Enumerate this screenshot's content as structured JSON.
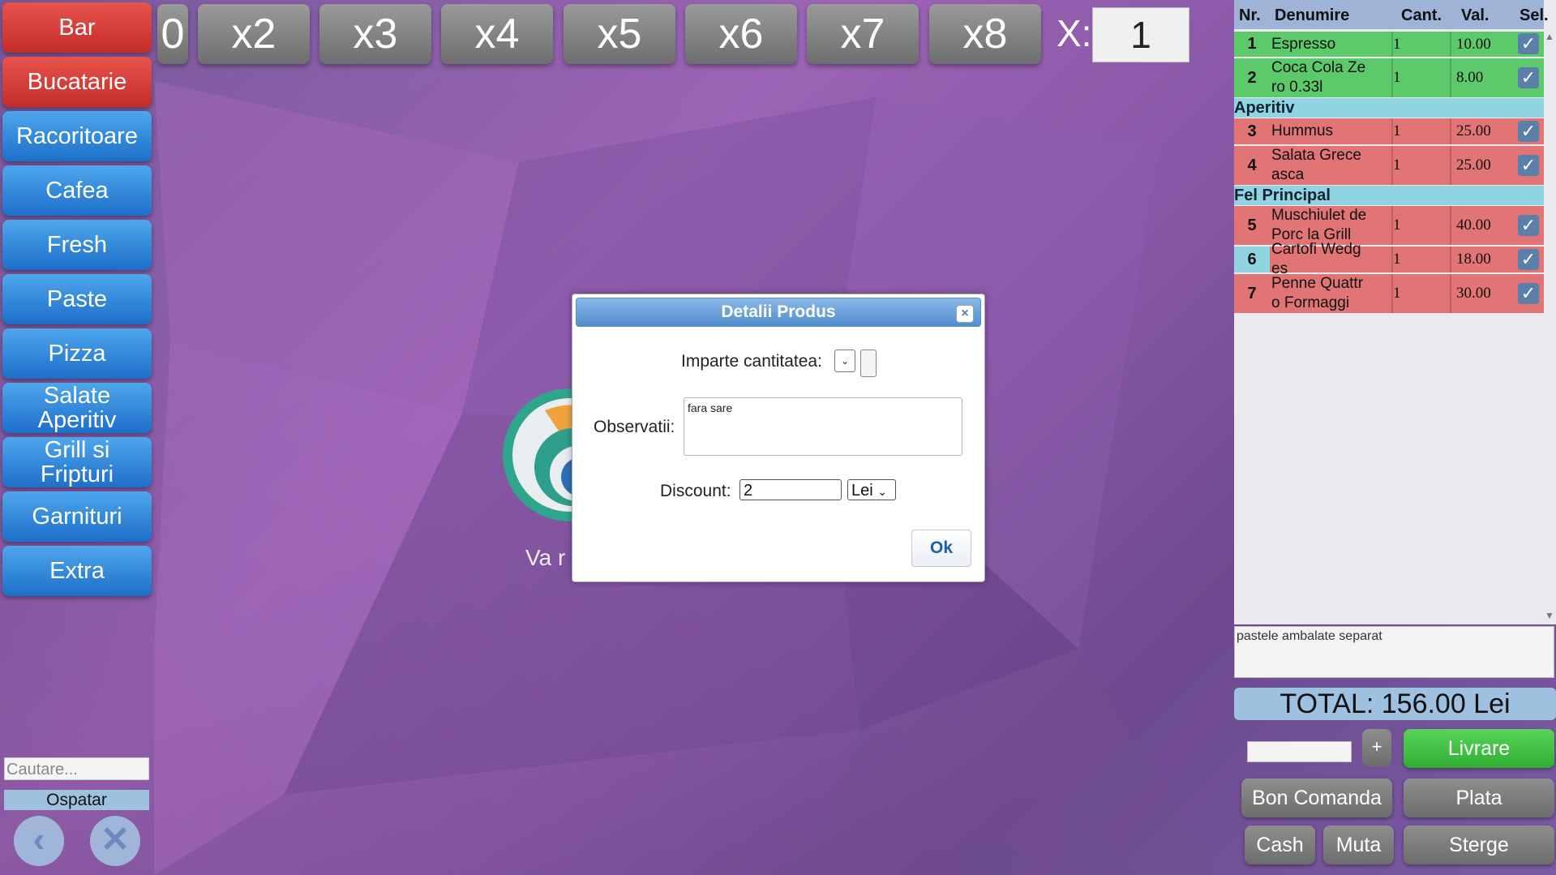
{
  "categories": [
    {
      "label": "Bar",
      "style": "red"
    },
    {
      "label": "Bucatarie",
      "style": "red"
    },
    {
      "label": "Racoritoare",
      "style": "blue"
    },
    {
      "label": "Cafea",
      "style": "blue"
    },
    {
      "label": "Fresh",
      "style": "blue"
    },
    {
      "label": "Paste",
      "style": "blue"
    },
    {
      "label": "Pizza",
      "style": "blue"
    },
    {
      "label": "Salate Aperitiv",
      "style": "blue"
    },
    {
      "label": "Grill si Fripturi",
      "style": "blue"
    },
    {
      "label": "Garnituri",
      "style": "blue"
    },
    {
      "label": "Extra",
      "style": "blue"
    }
  ],
  "multipliers": [
    "0",
    "x2",
    "x3",
    "x4",
    "x5",
    "x6",
    "x7",
    "x8"
  ],
  "multiplier_label": "X:",
  "multiplier_value": "1",
  "order": {
    "headers": {
      "nr": "Nr.",
      "name": "Denumire",
      "qty": "Cant.",
      "val": "Val.",
      "sel": "Sel."
    },
    "groups": [
      {
        "section": "",
        "rows": [
          {
            "nr": "1",
            "name": "Espresso",
            "qty": "1",
            "val": "10.00",
            "color": "green"
          },
          {
            "nr": "2",
            "name": "Coca Cola Zero 0.33l",
            "qty": "1",
            "val": "8.00",
            "color": "green"
          }
        ]
      },
      {
        "section": "Aperitiv",
        "rows": [
          {
            "nr": "3",
            "name": "Hummus",
            "qty": "1",
            "val": "25.00",
            "color": "red"
          },
          {
            "nr": "4",
            "name": "Salata Greceasca",
            "qty": "1",
            "val": "25.00",
            "color": "red"
          }
        ]
      },
      {
        "section": "Fel Principal",
        "rows": [
          {
            "nr": "5",
            "name": "Muschiulet de Porc la Grill",
            "qty": "1",
            "val": "40.00",
            "color": "red"
          },
          {
            "nr": "6",
            "name": "Cartofi Wedges",
            "qty": "1",
            "val": "18.00",
            "color": "red"
          },
          {
            "nr": "7",
            "name": "Penne Quattro Formaggi",
            "qty": "1",
            "val": "30.00",
            "color": "red"
          }
        ]
      }
    ],
    "notes": "pastele ambalate separat",
    "total": "TOTAL: 156.00 Lei"
  },
  "actions": {
    "plus": "+",
    "livrare": "Livrare",
    "bon_comanda": "Bon Comanda",
    "plata": "Plata",
    "cash": "Cash",
    "muta": "Muta",
    "sterge": "Sterge"
  },
  "search": {
    "placeholder": "Cautare..."
  },
  "waiter_label": "Ospatar",
  "welcome_text": "Va r",
  "modal": {
    "title": "Detalii Produs",
    "split_label": "Imparte cantitatea:",
    "observations_label": "Observatii:",
    "observations_value": "fara sare",
    "discount_label": "Discount:",
    "discount_value": "2",
    "discount_unit": "Lei",
    "ok_label": "Ok"
  },
  "colors": {
    "red_button": "#d23a36",
    "blue_button": "#2f86dd",
    "green_row": "#5cc96a",
    "red_row": "#e17474",
    "section_bg": "#8fd4e0",
    "total_bg": "#9fc1e0",
    "livrare_green": "#3cbf3f"
  }
}
